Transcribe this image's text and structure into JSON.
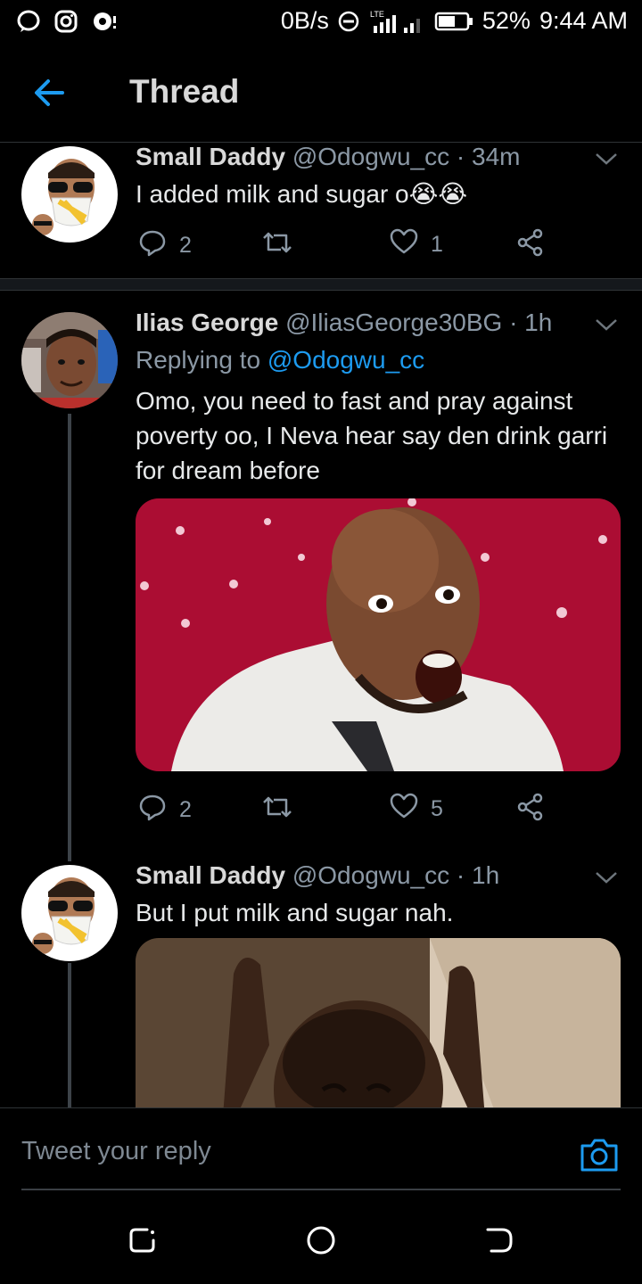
{
  "status_bar": {
    "speed": "0B/s",
    "network": "LTE",
    "battery": "52%",
    "time": "9:44 AM",
    "left_icons": [
      "messenger-icon",
      "instagram-icon",
      "notification-icon"
    ]
  },
  "header": {
    "title": "Thread"
  },
  "tweets": [
    {
      "name": "Small Daddy",
      "handle": "@Odogwu_cc",
      "time": "· 34m",
      "text": "I added milk and sugar o😭😭",
      "replies": "2",
      "retweets": "",
      "likes": "1"
    },
    {
      "name": "Ilias George",
      "handle": "@IliasGeorge30BG",
      "time": "· 1h",
      "replying_prefix": "Replying to ",
      "replying_to": "@Odogwu_cc",
      "text": "Omo, you need to fast and pray against poverty oo, I Neva hear say den drink garri for dream before",
      "replies": "2",
      "retweets": "",
      "likes": "5"
    },
    {
      "name": "Small Daddy",
      "handle": "@Odogwu_cc",
      "time": "· 1h",
      "text": "But I put milk and sugar nah."
    }
  ],
  "reply_box": {
    "placeholder": "Tweet your reply"
  },
  "colors": {
    "accent": "#1d9bf0",
    "muted": "#8b98a5",
    "background": "#000000"
  }
}
